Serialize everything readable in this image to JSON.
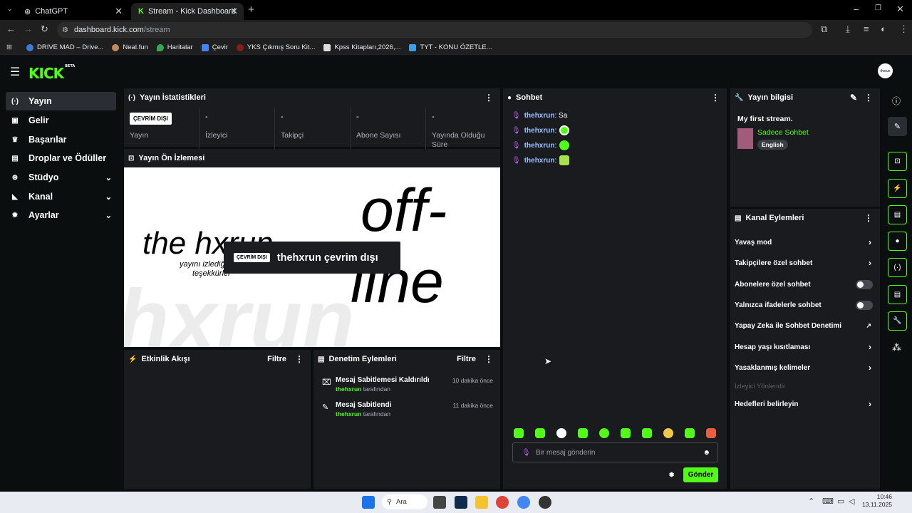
{
  "browser": {
    "tabs": [
      {
        "title": "ChatGPT",
        "active": false
      },
      {
        "title": "Stream - Kick Dashboard",
        "active": true
      }
    ],
    "url_host": "dashboard.kick.com",
    "url_path": "/stream",
    "bookmarks": [
      "DRIVE MAD – Drive...",
      "Neal.fun",
      "Haritalar",
      "Çevir",
      "YKS Çıkmış Soru Kit...",
      "Kpss Kitapları,2026,...",
      "TYT - KONU ÖZETLE..."
    ]
  },
  "app": {
    "logo": "KICK",
    "logo_sup": "BETA",
    "avatar_text": "thxrun"
  },
  "sidebar": {
    "items": [
      {
        "label": "Yayın",
        "icon": "broadcast-icon",
        "active": true
      },
      {
        "label": "Gelir",
        "icon": "money-icon"
      },
      {
        "label": "Başarılar",
        "icon": "trophy-icon"
      },
      {
        "label": "Droplar ve Ödüller",
        "icon": "gift-icon"
      },
      {
        "label": "Stüdyo",
        "icon": "studio-icon",
        "expandable": true
      },
      {
        "label": "Kanal",
        "icon": "channel-icon",
        "expandable": true
      },
      {
        "label": "Ayarlar",
        "icon": "gear-icon",
        "expandable": true
      }
    ]
  },
  "stats": {
    "title": "Yayın İstatistikleri",
    "status_badge": "ÇEVRİM DIŞI",
    "items": [
      {
        "value": "",
        "label": "Yayın"
      },
      {
        "value": "-",
        "label": "İzleyici"
      },
      {
        "value": "-",
        "label": "Takipçi"
      },
      {
        "value": "-",
        "label": "Abone Sayısı"
      },
      {
        "value": "-",
        "label": "Yayında Olduğu Süre"
      }
    ]
  },
  "preview": {
    "title": "Yayın Ön İzlemesi",
    "big1": "off-",
    "big2": "line",
    "handle": "the hxrun",
    "sub1": "yayını izlediğ",
    "sub2": "teşekkürler",
    "bg": "hxrun",
    "overlay_badge": "ÇEVRİM DIŞI",
    "overlay_text": "thehxrun çevrim dışı"
  },
  "activity": {
    "title": "Etkinlik Akışı",
    "filter": "Filtre"
  },
  "moderation": {
    "title": "Denetim Eylemleri",
    "filter": "Filtre",
    "items": [
      {
        "title": "Mesaj Sabitlemesi Kaldırıldı",
        "time": "10 dakika önce",
        "user": "thehxrun",
        "suffix": "tarafından"
      },
      {
        "title": "Mesaj Sabitlendi",
        "time": "11 dakika önce",
        "user": "thehxrun",
        "suffix": "tarafından"
      }
    ]
  },
  "chat": {
    "title": "Sohbet",
    "messages": [
      {
        "user": "thehxrun",
        "text": ": Sa"
      },
      {
        "user": "thehxrun",
        "text": ":"
      },
      {
        "user": "thehxrun",
        "text": ":"
      },
      {
        "user": "thehxrun",
        "text": ":"
      }
    ],
    "placeholder": "Bir mesaj gönderin",
    "send": "Gönder"
  },
  "info": {
    "title": "Yayın bilgisi",
    "stream_title": "My first stream.",
    "category": "Sadece Sohbet",
    "language": "English"
  },
  "actions": {
    "title": "Kanal Eylemleri",
    "items": [
      {
        "label": "Yavaş mod",
        "type": "chevron"
      },
      {
        "label": "Takipçilere özel sohbet",
        "type": "chevron"
      },
      {
        "label": "Abonelere özel sohbet",
        "type": "toggle"
      },
      {
        "label": "Yalnızca ifadelerle sohbet",
        "type": "toggle"
      },
      {
        "label": "Yapay Zeka ile Sohbet Denetimi",
        "type": "external"
      },
      {
        "label": "Hesap yaşı kısıtlaması",
        "type": "chevron"
      },
      {
        "label": "Yasaklanmış kelimeler",
        "type": "chevron"
      },
      {
        "label": "İzleyici Yönlendir",
        "type": "disabled"
      },
      {
        "label": "Hedefleri belirleyin",
        "type": "chevron"
      }
    ]
  },
  "taskbar": {
    "search": "Ara",
    "time": "10:46",
    "date": "13.11.2025"
  },
  "colors": {
    "accent": "#53fc18",
    "panel": "#191b1f",
    "bg": "#0b0e0f"
  }
}
